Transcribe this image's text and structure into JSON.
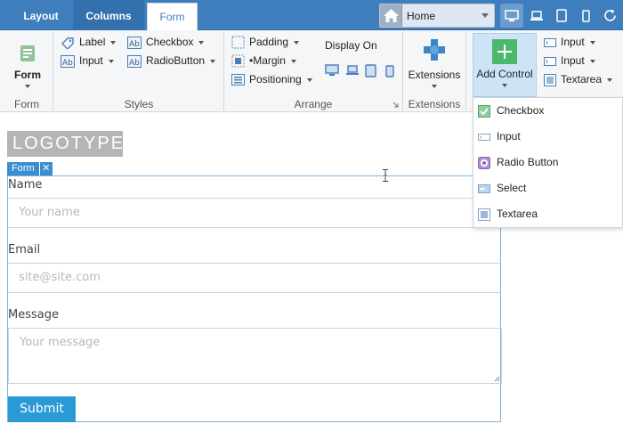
{
  "tabs": {
    "layout": "Layout",
    "columns": "Columns",
    "form": "Form"
  },
  "page_select": {
    "value": "Home"
  },
  "device_icons": [
    "desktop-icon",
    "laptop-icon",
    "tablet-icon",
    "phone-icon",
    "refresh-icon"
  ],
  "ribbon": {
    "form_group": {
      "button": "Form",
      "label": "Form"
    },
    "styles_group": {
      "label": "Styles",
      "items": {
        "label": "Label",
        "input": "Input",
        "checkbox": "Checkbox",
        "radiobutton": "RadioButton"
      }
    },
    "arrange_group": {
      "label": "Arrange",
      "items": {
        "padding": "Padding",
        "margin": "•Margin",
        "positioning": "Positioning"
      },
      "display_on": "Display On"
    },
    "extensions_group": {
      "button": "Extensions",
      "label": "Extensions"
    },
    "controls_group": {
      "add_control": "Add Control",
      "items": {
        "input1": "Input",
        "input2": "Input",
        "textarea": "Textarea"
      }
    }
  },
  "add_control_menu": [
    "Checkbox",
    "Input",
    "Radio Button",
    "Select",
    "Textarea"
  ],
  "canvas": {
    "logo": "LOGOTYPE",
    "form_tag": "Form",
    "close_glyph": "✕",
    "fields": {
      "name_label": "Name",
      "name_placeholder": "Your name",
      "email_label": "Email",
      "email_placeholder": "site@site.com",
      "message_label": "Message",
      "message_placeholder": "Your message"
    },
    "submit": "Submit"
  },
  "colors": {
    "topbar": "#3f7ebd",
    "accent": "#2a9ad6",
    "add_control_bg": "#cde4f7",
    "add_green": "#4cb86c"
  }
}
